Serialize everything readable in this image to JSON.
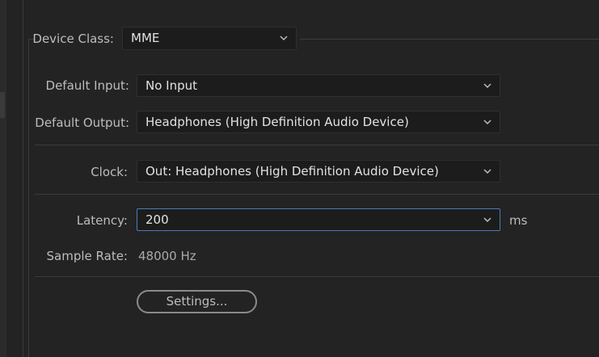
{
  "device_class": {
    "label": "Device Class:",
    "value": "MME"
  },
  "default_input": {
    "label": "Default Input:",
    "value": "No Input"
  },
  "default_output": {
    "label": "Default Output:",
    "value": "Headphones (High Definition Audio Device)"
  },
  "clock": {
    "label": "Clock:",
    "value": "Out: Headphones (High Definition Audio Device)"
  },
  "latency": {
    "label": "Latency:",
    "value": "200",
    "unit": "ms"
  },
  "sample_rate": {
    "label": "Sample Rate:",
    "value": "48000 Hz"
  },
  "settings_button": {
    "label": "Settings..."
  },
  "colors": {
    "background": "#232323",
    "field": "#1c1c1c",
    "focus_border": "#4a7cb8",
    "text": "#e2e2e2",
    "label": "#bdbdbd"
  },
  "icons": {
    "dropdown": "chevron-down-icon"
  }
}
